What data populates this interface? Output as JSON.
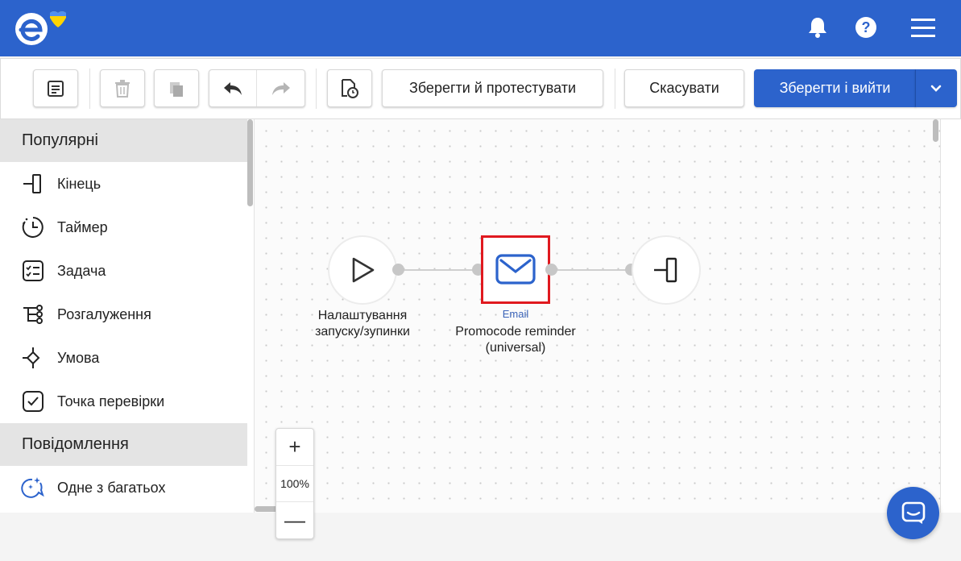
{
  "header": {
    "logo_icon": "esputnik-logo-icon",
    "notifications_icon": "bell-icon",
    "help_icon": "help-icon",
    "menu_icon": "hamburger-menu-icon"
  },
  "toolbar": {
    "save_and_test_label": "Зберегти й протестувати",
    "cancel_label": "Скасувати",
    "save_and_exit_label": "Зберегти і вийти"
  },
  "sidebar": {
    "sections": [
      {
        "title": "Популярні",
        "items": [
          {
            "label": "Кінець",
            "icon": "end-icon"
          },
          {
            "label": "Таймер",
            "icon": "timer-icon"
          },
          {
            "label": "Задача",
            "icon": "task-icon"
          },
          {
            "label": "Розгалуження",
            "icon": "branching-icon"
          },
          {
            "label": "Умова",
            "icon": "condition-icon"
          },
          {
            "label": "Точка перевірки",
            "icon": "checkpoint-icon"
          }
        ]
      },
      {
        "title": "Повідомлення",
        "items": [
          {
            "label": "Одне з багатьох",
            "icon": "one-of-many-icon"
          }
        ]
      }
    ]
  },
  "canvas": {
    "nodes": [
      {
        "type": "start",
        "icon": "play-icon",
        "label_line1": "Налаштування",
        "label_line2": "запуску/зупинки"
      },
      {
        "type": "email",
        "icon": "envelope-icon",
        "type_label": "Email",
        "label_line1": "Promocode reminder",
        "label_line2": "(universal)",
        "highlighted": true,
        "highlight_color": "#e0191f"
      },
      {
        "type": "end",
        "icon": "end-icon"
      }
    ]
  },
  "zoom": {
    "level": "100%",
    "plus": "+",
    "minus": "—"
  },
  "colors": {
    "brand": "#2c63cc",
    "highlight": "#e0191f"
  }
}
